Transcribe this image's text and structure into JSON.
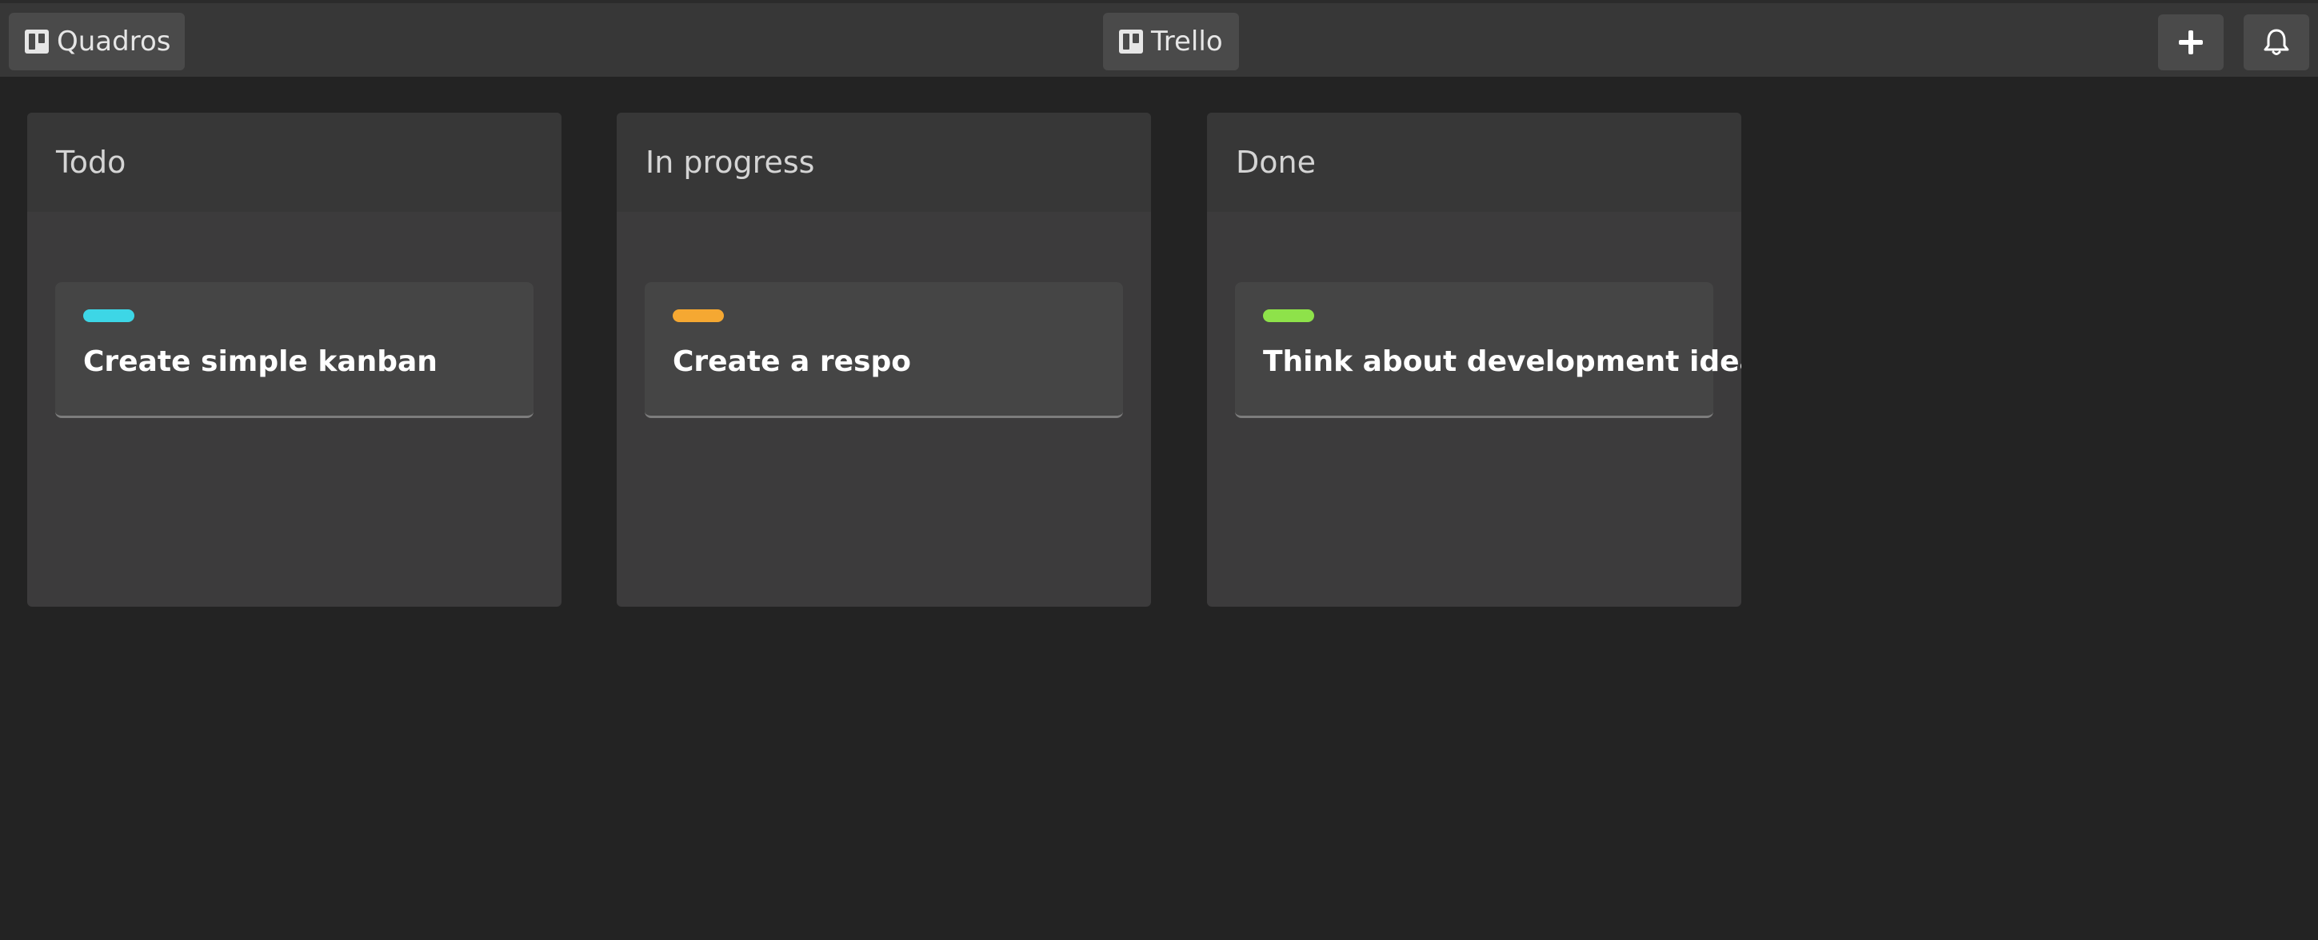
{
  "topbar": {
    "boards_button_label": "Quadros",
    "app_logo_label": "Trello",
    "add_icon": "plus-icon",
    "notifications_icon": "bell-icon"
  },
  "lists": [
    {
      "title": "Todo",
      "cards": [
        {
          "label_color": "#3dd6e6",
          "title": "Create simple kanban"
        }
      ]
    },
    {
      "title": "In progress",
      "cards": [
        {
          "label_color": "#f5a832",
          "title": "Create a respo"
        }
      ]
    },
    {
      "title": "Done",
      "cards": [
        {
          "label_color": "#8ee24a",
          "title": "Think about development idea"
        }
      ]
    }
  ]
}
